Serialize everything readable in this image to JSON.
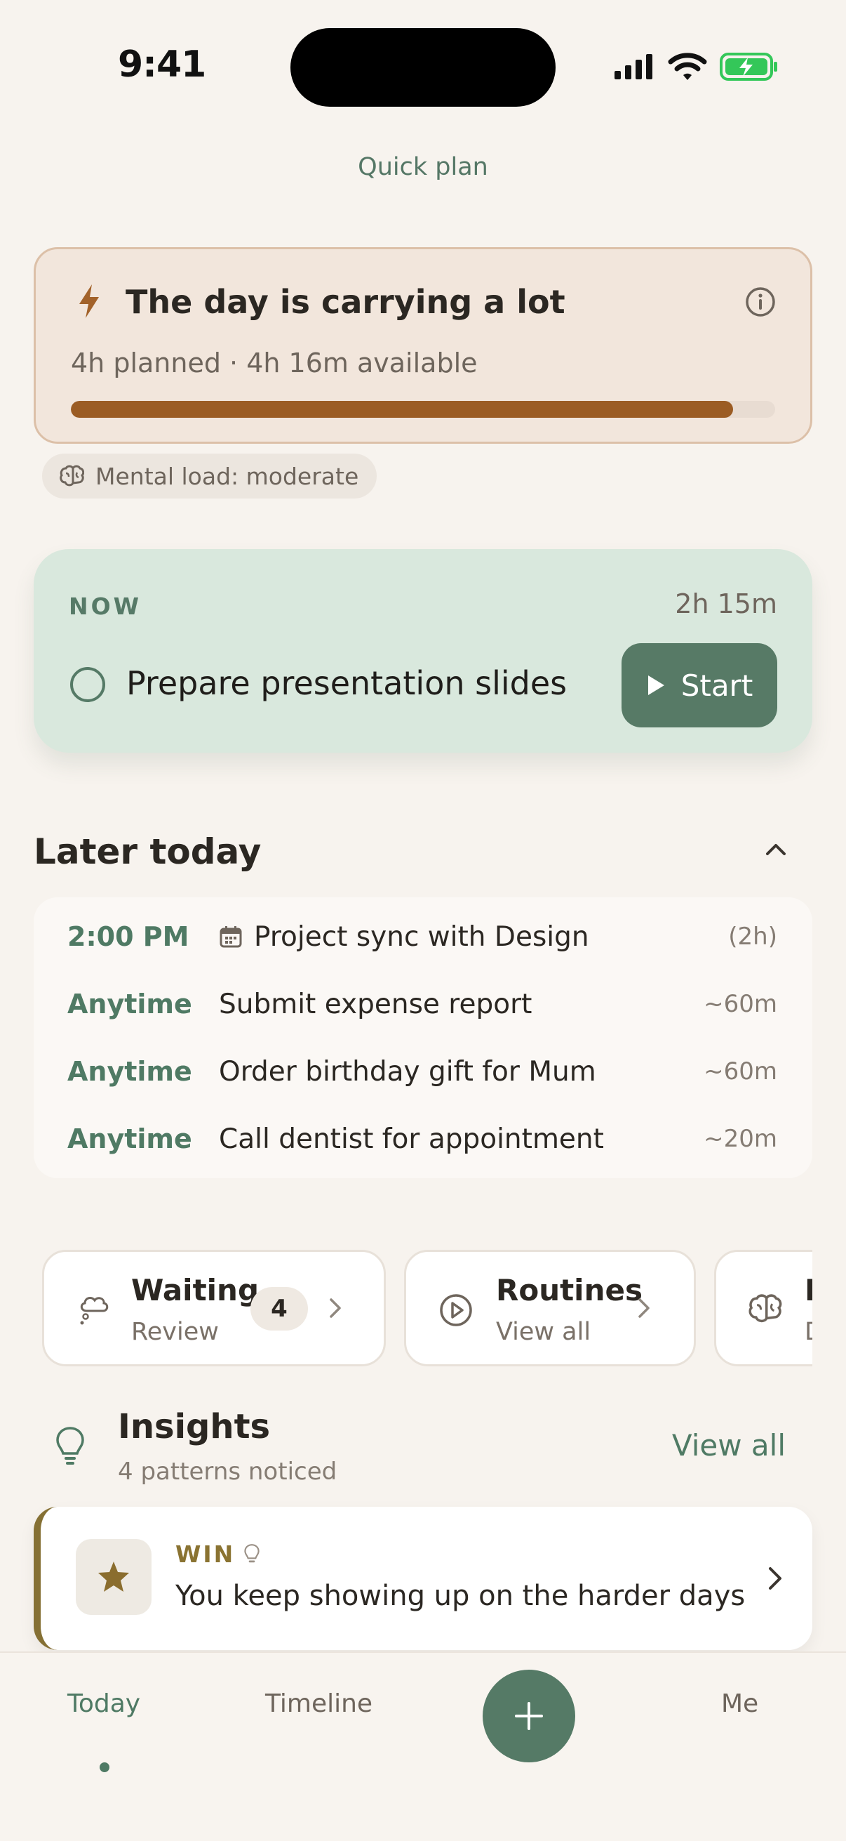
{
  "status_bar": {
    "time": "9:41"
  },
  "header": {
    "title": "Quick plan"
  },
  "load_card": {
    "title": "The day is carrying a lot",
    "summary": "4h planned · 4h 16m available",
    "progress_fraction": 0.94,
    "accent_color": "#9b5c24"
  },
  "mental_load": {
    "label": "Mental load: moderate"
  },
  "now": {
    "label": "NOW",
    "duration": "2h 15m",
    "task": "Prepare presentation slides",
    "start_label": "Start"
  },
  "later_today": {
    "title": "Later today",
    "items": [
      {
        "time": "2:00 PM",
        "task": "Project sync with Design",
        "duration": "(2h)",
        "icon": "calendar-icon"
      },
      {
        "time": "Anytime",
        "task": "Submit expense report",
        "duration": "~60m"
      },
      {
        "time": "Anytime",
        "task": "Order birthday gift for Mum",
        "duration": "~60m"
      },
      {
        "time": "Anytime",
        "task": "Call dentist for appointment",
        "duration": "~20m"
      }
    ]
  },
  "chips": [
    {
      "title": "Waiting",
      "subtitle": "Review",
      "badge": "4",
      "icon": "thought-cloud-icon"
    },
    {
      "title": "Routines",
      "subtitle": "View all",
      "icon": "play-circle-icon"
    },
    {
      "title": "L",
      "subtitle": "D",
      "icon": "brain-icon"
    }
  ],
  "insights": {
    "title": "Insights",
    "subtitle": "4 patterns noticed",
    "view_all": "View all",
    "win": {
      "label": "WIN",
      "text": "You keep showing up on the harder days"
    }
  },
  "tabbar": {
    "today": "Today",
    "timeline": "Timeline",
    "me": "Me"
  },
  "colors": {
    "brand_green": "#557a66",
    "background": "#f7f3ee",
    "now_card": "#d9e8dd"
  }
}
